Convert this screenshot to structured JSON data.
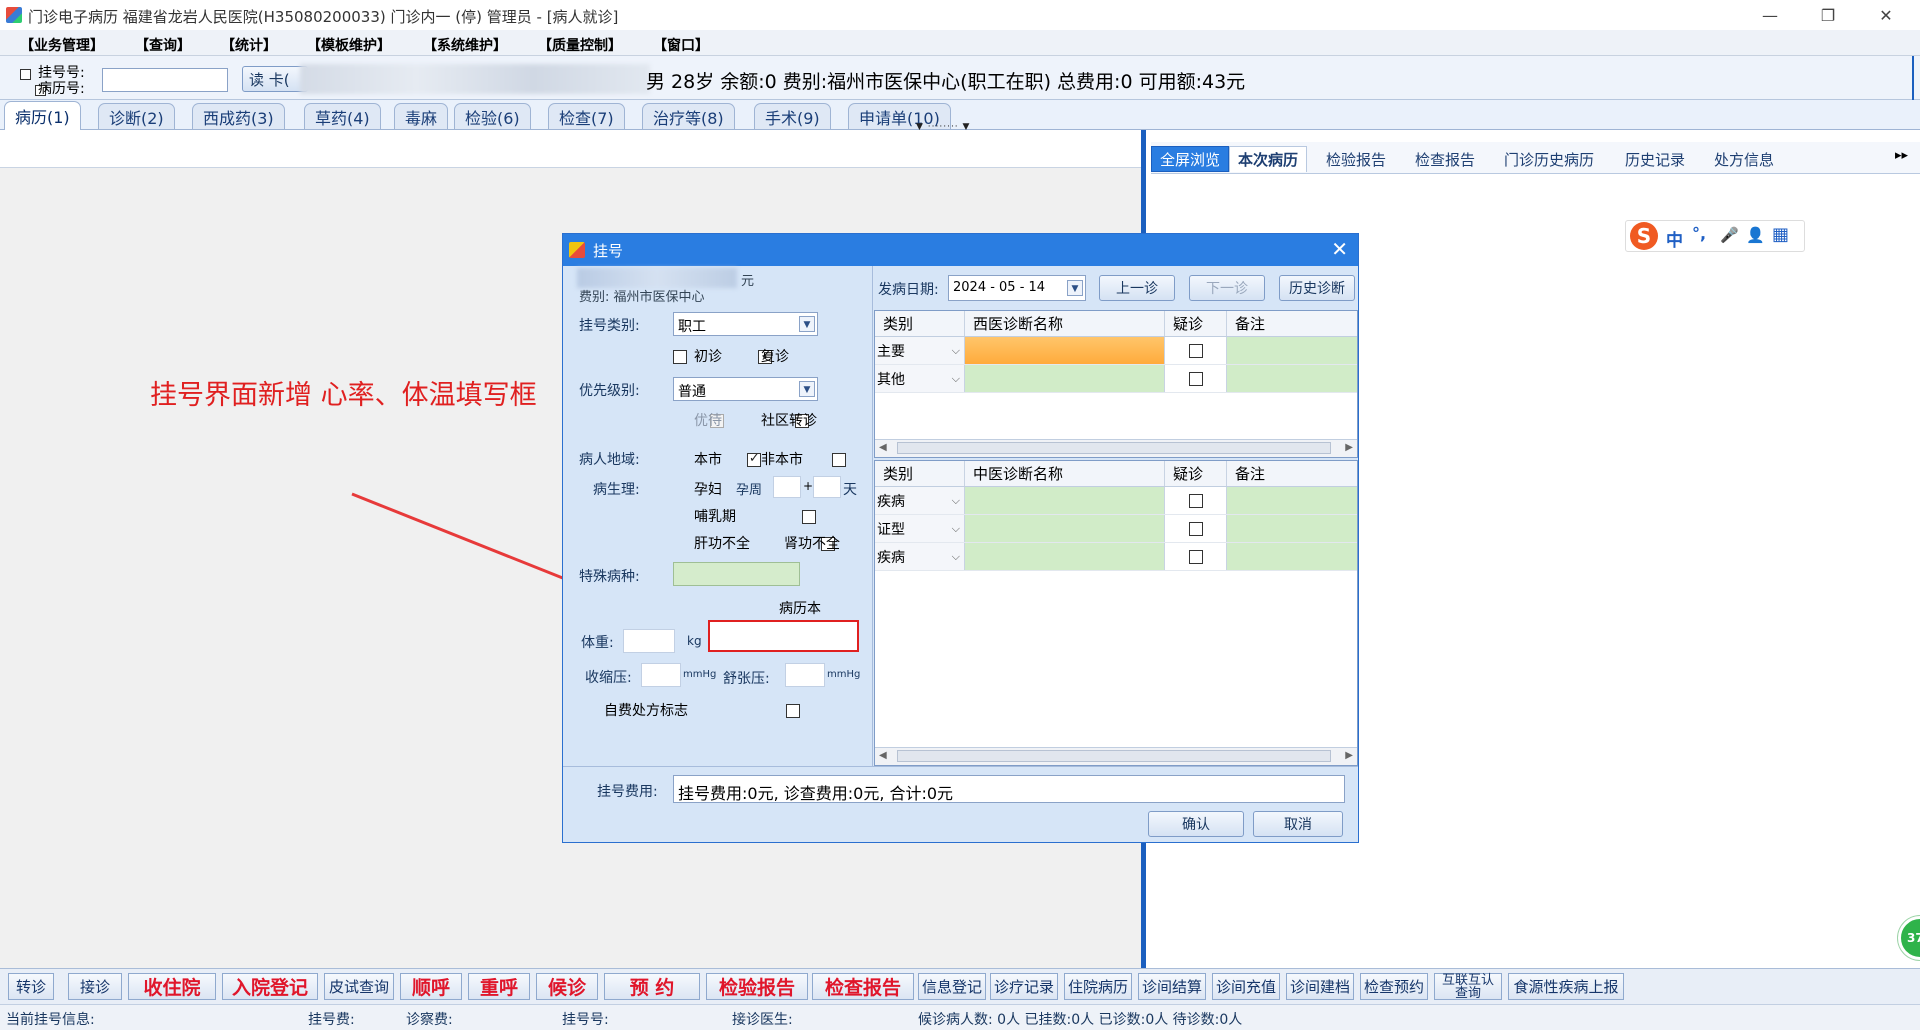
{
  "window": {
    "title": "门诊电子病历  福建省龙岩人民医院(H35080200033) 门诊内一 (停)    管理员 - [病人就诊]",
    "minimize": "—",
    "restore": "❐",
    "close": "✕"
  },
  "menu": [
    "【业务管理】",
    "【查询】",
    "【统计】",
    "【模板维护】",
    "【系统维护】",
    "【质量控制】",
    "【窗口】"
  ],
  "patient_bar": {
    "reg_no_label": "挂号号:",
    "record_no_label": "病历号:",
    "read_card": "读 卡(",
    "summary": "男 28岁  余额:0  费别:福州市医保中心(职工在职) 总费用:0  可用额:43元"
  },
  "main_tabs": [
    "病历(1)",
    "诊断(2)",
    "西成药(3)",
    "草药(4)",
    "毒麻",
    "检验(6)",
    "检查(7)",
    "治疗等(8)",
    "手术(9)",
    "申请单(10)"
  ],
  "right_tabs": [
    "全屏浏览",
    "本次病历",
    "检验报告",
    "检查报告",
    "门诊历史病历",
    "历史记录",
    "处方信息"
  ],
  "right_more": "▸▸",
  "ime": {
    "logo": "S",
    "zh": "中",
    "punct": "°,",
    "mic": "🎤",
    "user": "👤",
    "grid": "▦"
  },
  "annotation": "挂号界面新增 心率、体温填写框",
  "dialog": {
    "title": "挂号",
    "close": "✕",
    "fee_suffix": "元",
    "fee_type": "费别: 福州市医保中心",
    "reg_type_label": "挂号类别:",
    "reg_type_value": "职工",
    "first_visit": "初诊",
    "return_visit": "复诊",
    "priority_label": "优先级别:",
    "priority_value": "普通",
    "preferential": "优待",
    "community_transfer": "社区转诊",
    "region_label": "病人地域:",
    "local": "本市",
    "nonlocal": "非本市",
    "physio_label": "病生理:",
    "pregnant": "孕妇",
    "gest_week": "孕周",
    "plus": "+",
    "day": "天",
    "lactation": "哺乳期",
    "liver": "肝功不全",
    "kidney": "肾功不全",
    "special_label": "特殊病种:",
    "record_book": "病历本",
    "weight_label": "体重:",
    "kg": "kg",
    "systolic_label": "收缩压:",
    "mmhg": "mmHg",
    "diastolic_label": "舒张压:",
    "self_pay": "自费处方标志",
    "onset_label": "发病日期:",
    "onset_date": "2024 - 05 - 14",
    "prev_btn": "上一诊",
    "next_btn": "下一诊",
    "history_btn": "历史诊断",
    "west_headers": [
      "类别",
      "西医诊断名称",
      "疑诊",
      "备注"
    ],
    "west_rows": [
      "主要",
      "其他"
    ],
    "tcm_headers": [
      "类别",
      "中医诊断名称",
      "疑诊",
      "备注"
    ],
    "tcm_rows": [
      "疾病",
      "证型",
      "疾病"
    ],
    "reg_fee_label": "挂号费用:",
    "reg_fee_text": "挂号费用:0元, 诊查费用:0元, 合计:0元",
    "ok": "确认",
    "cancel": "取消"
  },
  "bottom_buttons": [
    "转诊",
    "接诊",
    "收住院",
    "入院登记",
    "皮试查询",
    "顺呼",
    "重呼",
    "候诊",
    "预    约",
    "检验报告",
    "检查报告",
    "信息登记",
    "诊疗记录",
    "住院病历",
    "诊间结算",
    "诊间充值",
    "诊间建档",
    "检查预约",
    "互联互认查询",
    "食源性疾病上报"
  ],
  "status": {
    "current": "当前挂号信息:",
    "reg_fee": "挂号费:",
    "exam_fee": "诊察费:",
    "reg_no": "挂号号:",
    "doctor": "接诊医生:",
    "counts": "候诊病人数: 0人  已挂数:0人  已诊数:0人  待诊数:0人"
  },
  "side_badge": "37",
  "colors": {
    "accent": "#2a7de1",
    "annotation": "#e02020",
    "highlight_box": "#e02020"
  }
}
